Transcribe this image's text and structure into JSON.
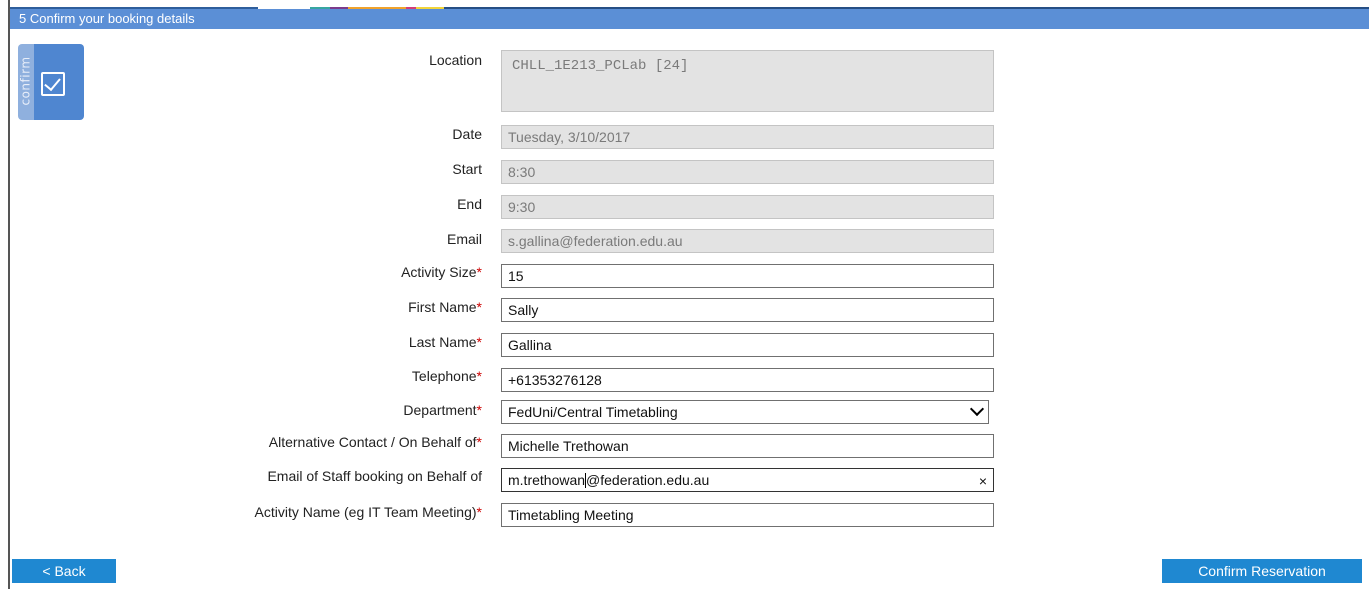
{
  "header": {
    "title": "5  Confirm your booking details"
  },
  "icon": {
    "label": "confirm"
  },
  "form": {
    "location": {
      "label": "Location",
      "value": "CHLL_1E213_PCLab [24]"
    },
    "date": {
      "label": "Date",
      "value": "Tuesday, 3/10/2017"
    },
    "start": {
      "label": "Start",
      "value": "8:30"
    },
    "end": {
      "label": "End",
      "value": "9:30"
    },
    "email": {
      "label": "Email",
      "value": "s.gallina@federation.edu.au"
    },
    "activity_size": {
      "label": "Activity Size",
      "value": "15"
    },
    "first_name": {
      "label": "First Name",
      "value": "Sally"
    },
    "last_name": {
      "label": "Last Name",
      "value": "Gallina"
    },
    "telephone": {
      "label": "Telephone",
      "value": "+61353276128"
    },
    "department": {
      "label": "Department",
      "value": "FedUni/Central Timetabling"
    },
    "alt_contact": {
      "label": "Alternative Contact / On Behalf of",
      "value": "Michelle Trethowan"
    },
    "staff_email": {
      "label": "Email of Staff booking on Behalf of",
      "value_before_caret": "m.trethowan",
      "value_after_caret": "@federation.edu.au",
      "clear": "×"
    },
    "activity_name": {
      "label": "Activity Name (eg IT Team Meeting)",
      "value": "Timetabling Meeting"
    },
    "required_marker": "*"
  },
  "buttons": {
    "back": "< Back",
    "confirm": "Confirm Reservation"
  },
  "colors": {
    "header": "#5b8fd6",
    "button": "#1f88d1",
    "required": "#cc0000",
    "readonly_bg": "#e3e3e3"
  }
}
